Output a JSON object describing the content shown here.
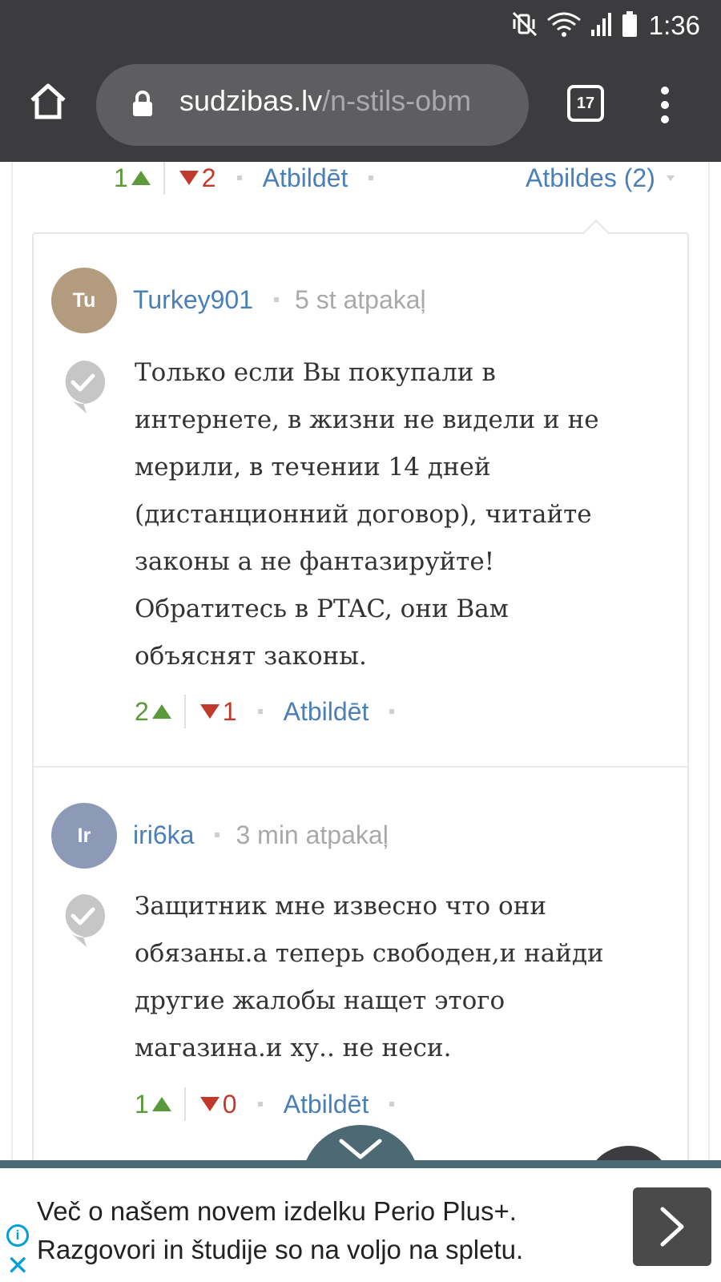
{
  "status_bar": {
    "time": "1:36",
    "icons": [
      "mute-vibrate-icon",
      "wifi-icon",
      "signal-icon",
      "battery-icon"
    ]
  },
  "browser": {
    "url_host": "sudzibas.lv",
    "url_path": "/n-stils-obm",
    "tab_count": "17",
    "icons": [
      "home-icon",
      "lock-icon",
      "tabs-icon",
      "more-vert-icon"
    ]
  },
  "parent_comment": {
    "upvotes": "1",
    "downvotes": "2",
    "reply_label": "Atbildēt",
    "replies_label": "Atbildes (2)"
  },
  "comments": [
    {
      "avatar_initials": "Tu",
      "avatar_color": "#b39b7f",
      "author": "Turkey901",
      "time_ago": "5 st atpakaļ",
      "text_lines": [
        "Только если Вы покупали в",
        "интернете, в жизни не видели и не",
        "мерили, в течении 14 дней",
        "(дистанционний договор), читайте",
        "законы а не фантазируйте!",
        "Обратитесь в PTAC, они Вам",
        "объяснят законы."
      ],
      "upvotes": "2",
      "downvotes": "1",
      "reply_label": "Atbildēt"
    },
    {
      "avatar_initials": "Ir",
      "avatar_color": "#8c9ab8",
      "author": "iri6ka",
      "time_ago": "3 min atpakaļ",
      "text_lines": [
        "Защитник мне извесно что они",
        "обязаны.а теперь свободен,и найди",
        "другие жалобы нащет этого",
        "магазина.и ху.. не неси."
      ],
      "upvotes": "1",
      "downvotes": "0",
      "reply_label": "Atbildēt"
    }
  ],
  "ad": {
    "line1": "Več o našem novem izdelku Perio Plus+.",
    "line2": "Razgovori in študije so na voljo na spletu.",
    "icons": [
      "info-icon",
      "close-icon",
      "chevron-right-icon"
    ]
  },
  "colors": {
    "upvote": "#5a9a3a",
    "downvote": "#c0392b",
    "link": "#4a7fb8",
    "chrome_bg": "#3c3c3e",
    "accent_bar": "#4d6974"
  }
}
